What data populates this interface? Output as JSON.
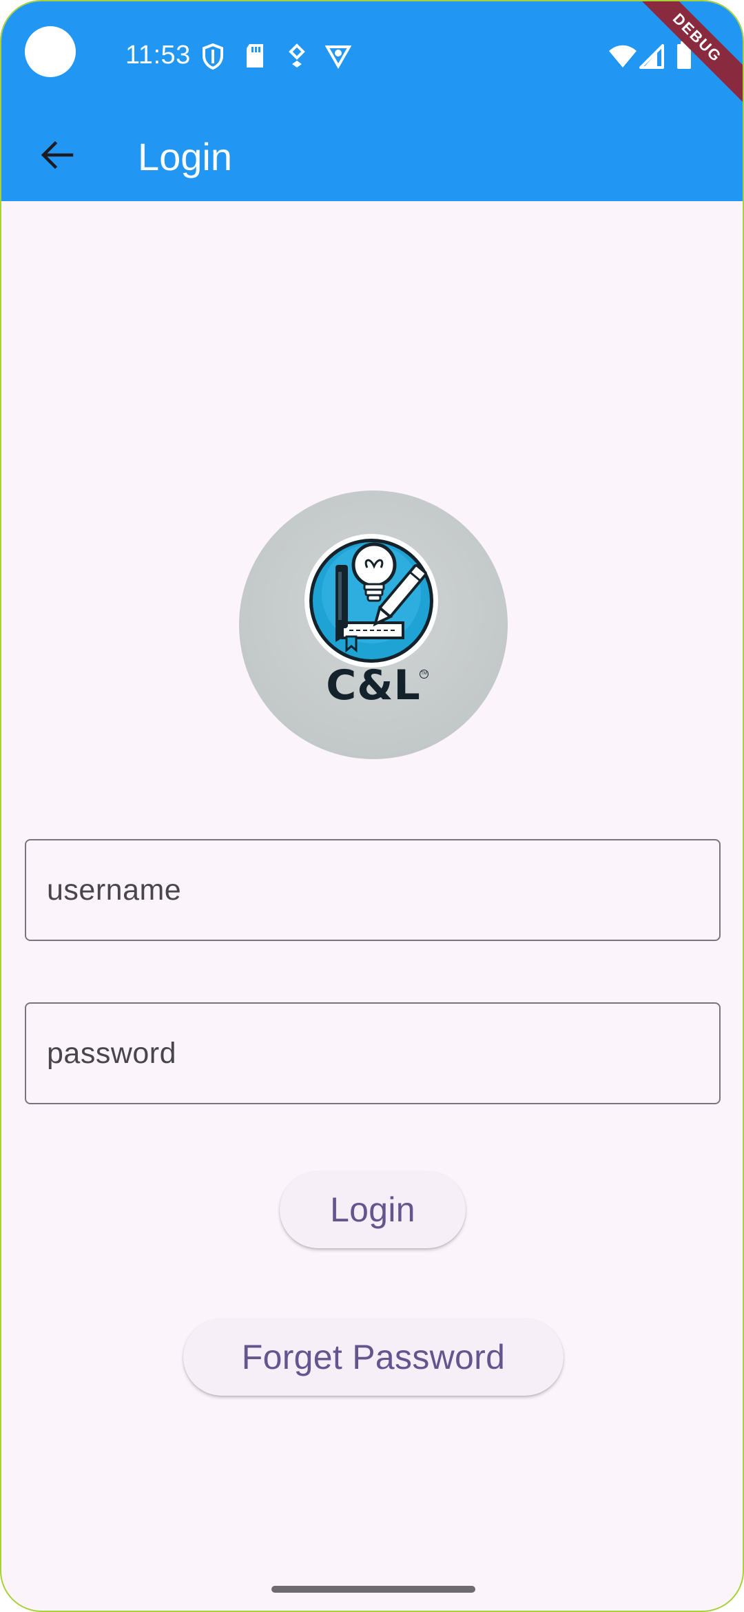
{
  "status_bar": {
    "time": "11:53",
    "left_icons": [
      "shield-icon",
      "sd-card-icon",
      "location-icon",
      "vpn-icon"
    ],
    "right_icons": [
      "wifi-icon",
      "signal-icon",
      "battery-icon"
    ]
  },
  "debug_banner": {
    "label": "DEBUG"
  },
  "app_bar": {
    "title": "Login",
    "back_icon": "arrow-back-icon",
    "color": "#2196f3"
  },
  "logo": {
    "text": "C&L",
    "tm": "TM",
    "icon": "lightbulb-pen-book-logo"
  },
  "form": {
    "username": {
      "placeholder": "username",
      "value": ""
    },
    "password": {
      "placeholder": "password",
      "value": ""
    }
  },
  "buttons": {
    "login": "Login",
    "forget_password": "Forget Password"
  },
  "colors": {
    "primary": "#2196f3",
    "background": "#fcf4fb",
    "button_text": "#65558f",
    "button_bg": "#f6eff7",
    "outline": "#79747e"
  }
}
